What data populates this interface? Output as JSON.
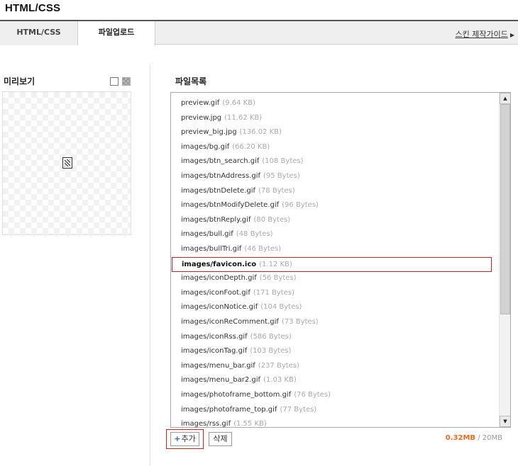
{
  "header": {
    "title": "HTML/CSS"
  },
  "tabs": [
    {
      "label": "HTML/CSS"
    },
    {
      "label": "파일업로드"
    }
  ],
  "guide_link": {
    "label": "스킨 제작가이드",
    "arrow": "▶"
  },
  "preview": {
    "title": "미리보기",
    "bg_options": [
      "white",
      "gray"
    ],
    "current_icon": "favicon-icon"
  },
  "file_list": {
    "title": "파일목록",
    "items": [
      {
        "name": "preview.gif",
        "size": "(9.64 KB)"
      },
      {
        "name": "preview.jpg",
        "size": "(11.62 KB)"
      },
      {
        "name": "preview_big.jpg",
        "size": "(136.02 KB)"
      },
      {
        "name": "images/bg.gif",
        "size": "(66.20 KB)"
      },
      {
        "name": "images/btn_search.gif",
        "size": "(108 Bytes)"
      },
      {
        "name": "images/btnAddress.gif",
        "size": "(95 Bytes)"
      },
      {
        "name": "images/btnDelete.gif",
        "size": "(78 Bytes)"
      },
      {
        "name": "images/btnModifyDelete.gif",
        "size": "(96 Bytes)"
      },
      {
        "name": "images/btnReply.gif",
        "size": "(80 Bytes)"
      },
      {
        "name": "images/bull.gif",
        "size": "(48 Bytes)"
      },
      {
        "name": "images/bullTri.gif",
        "size": "(46 Bytes)"
      },
      {
        "name": "images/favicon.ico",
        "size": "(1.12 KB)",
        "selected": true
      },
      {
        "name": "images/iconDepth.gif",
        "size": "(56 Bytes)"
      },
      {
        "name": "images/iconFoot.gif",
        "size": "(171 Bytes)"
      },
      {
        "name": "images/iconNotice.gif",
        "size": "(104 Bytes)"
      },
      {
        "name": "images/iconReComment.gif",
        "size": "(73 Bytes)"
      },
      {
        "name": "images/iconRss.gif",
        "size": "(586 Bytes)"
      },
      {
        "name": "images/iconTag.gif",
        "size": "(103 Bytes)"
      },
      {
        "name": "images/menu_bar.gif",
        "size": "(237 Bytes)"
      },
      {
        "name": "images/menu_bar2.gif",
        "size": "(1.03 KB)"
      },
      {
        "name": "images/photoframe_bottom.gif",
        "size": "(76 Bytes)"
      },
      {
        "name": "images/photoframe_top.gif",
        "size": "(77 Bytes)"
      },
      {
        "name": "images/rss.gif",
        "size": "(1.55 KB)"
      }
    ]
  },
  "buttons": {
    "add_plus": "+",
    "add": "추가",
    "delete": "삭제"
  },
  "usage": {
    "used": "0.32MB",
    "separator": " / ",
    "total": "20MB"
  },
  "colors": {
    "accent_red": "#c2272d",
    "usage_orange": "#ee6a1f",
    "plus_blue": "#2d63c8"
  }
}
